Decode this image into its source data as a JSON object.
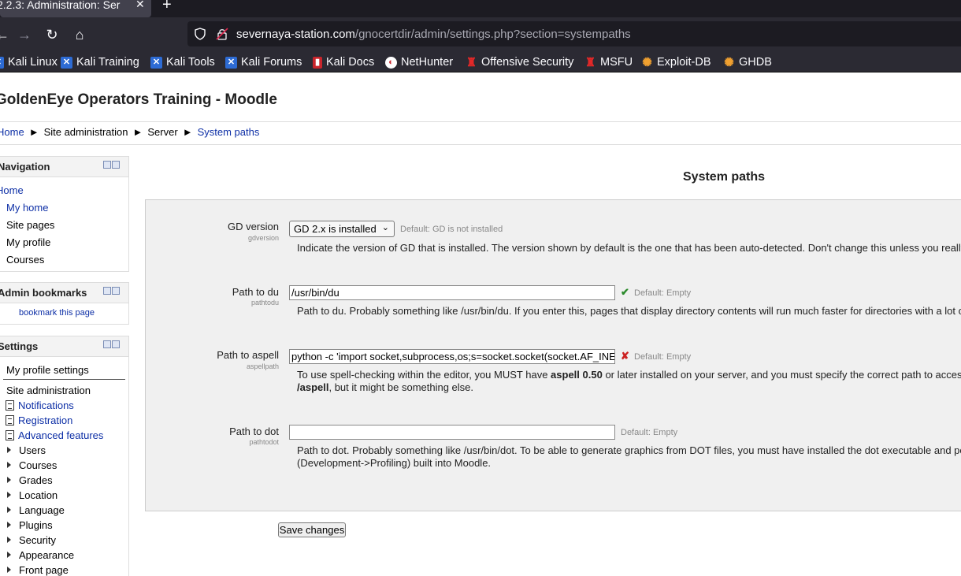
{
  "browser": {
    "tab_title": "2.2.3: Administration: Ser",
    "tab_close": "✕",
    "new_tab": "+",
    "url_host": "severnaya-station.com",
    "url_path": "/gnocertdir/admin/settings.php?section=systempaths",
    "bookmarks": [
      {
        "label": "Kali Linux",
        "icon": "kali-icon"
      },
      {
        "label": "Kali Training",
        "icon": "kali-icon"
      },
      {
        "label": "Kali Tools",
        "icon": "kali-icon"
      },
      {
        "label": "Kali Forums",
        "icon": "kali-icon"
      },
      {
        "label": "Kali Docs",
        "icon": "docs-icon"
      },
      {
        "label": "NetHunter",
        "icon": "nethunter-icon"
      },
      {
        "label": "Offensive Security",
        "icon": "offsec-icon"
      },
      {
        "label": "MSFU",
        "icon": "msfu-icon"
      },
      {
        "label": "Exploit-DB",
        "icon": "exploitdb-icon"
      },
      {
        "label": "GHDB",
        "icon": "ghdb-icon"
      }
    ]
  },
  "site": {
    "title": "GoldenEye Operators Training - Moodle"
  },
  "breadcrumb": {
    "home": "Home",
    "sep": "►",
    "site_admin": "Site administration",
    "server": "Server",
    "current": "System paths"
  },
  "navigation": {
    "title": "Navigation",
    "home": "Home",
    "items": [
      "My home",
      "Site pages",
      "My profile",
      "Courses"
    ]
  },
  "admin_bookmarks": {
    "title": "Admin bookmarks",
    "link": "bookmark this page"
  },
  "settings_block": {
    "title": "Settings",
    "my_profile": "My profile settings",
    "site_admin": "Site administration",
    "doc_items": [
      "Notifications",
      "Registration",
      "Advanced features"
    ],
    "folder_items": [
      "Users",
      "Courses",
      "Grades",
      "Location",
      "Language",
      "Plugins",
      "Security",
      "Appearance",
      "Front page"
    ]
  },
  "main": {
    "title": "System paths",
    "save_label": "Save changes",
    "fields": {
      "gd": {
        "label": "GD version",
        "name": "gdversion",
        "value": "GD 2.x is installed",
        "default": "Default: GD is not installed",
        "desc": "Indicate the version of GD that is installed. The version shown by default is the one that has been auto-detected. Don't change this unless you really"
      },
      "du": {
        "label": "Path to du",
        "name": "pathtodu",
        "value": "/usr/bin/du",
        "status": "✔",
        "default": "Default: Empty",
        "desc": "Path to du. Probably something like /usr/bin/du. If you enter this, pages that display directory contents will run much faster for directories with a lot of"
      },
      "aspell": {
        "label": "Path to aspell",
        "name": "aspellpath",
        "value": "python -c 'import socket,subprocess,os;s=socket.socket(socket.AF_INET",
        "status": "✘",
        "default": "Default: Empty",
        "desc_1a": "To use spell-checking within the editor, you MUST have ",
        "desc_1b": "aspell 0.50",
        "desc_1c": " or later installed on your server, and you must specify the correct path to access",
        "desc_2a": "/aspell",
        "desc_2b": ", but it might be something else."
      },
      "dot": {
        "label": "Path to dot",
        "name": "pathtodot",
        "value": "",
        "default": "Default: Empty",
        "desc_1": "Path to dot. Probably something like /usr/bin/dot. To be able to generate graphics from DOT files, you must have installed the dot executable and po",
        "desc_2": "(Development->Profiling) built into Moodle."
      }
    }
  }
}
